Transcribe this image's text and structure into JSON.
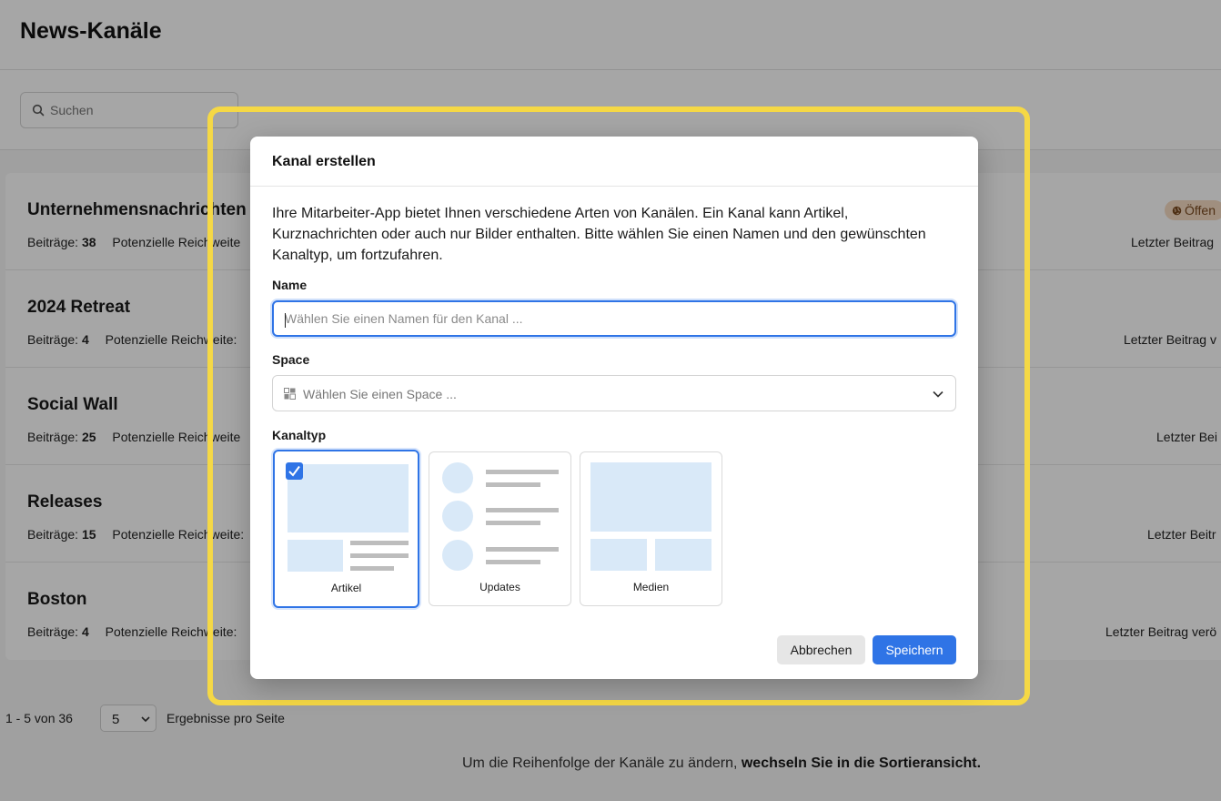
{
  "page": {
    "title": "News-Kanäle",
    "search_placeholder": "Suchen"
  },
  "channels": [
    {
      "name": "Unternehmensnachrichten",
      "posts_label": "Beiträge:",
      "posts": "38",
      "reach_label": "Potenzielle Reichweite",
      "last": "Letzter Beitrag",
      "badge": "Öffen"
    },
    {
      "name": "2024 Retreat",
      "posts_label": "Beiträge:",
      "posts": "4",
      "reach_label": "Potenzielle Reichweite:",
      "last": "Letzter Beitrag v"
    },
    {
      "name": "Social Wall",
      "posts_label": "Beiträge:",
      "posts": "25",
      "reach_label": "Potenzielle Reichweite",
      "last": "Letzter Bei"
    },
    {
      "name": "Releases",
      "posts_label": "Beiträge:",
      "posts": "15",
      "reach_label": "Potenzielle Reichweite:",
      "last": "Letzter Beitr"
    },
    {
      "name": "Boston",
      "posts_label": "Beiträge:",
      "posts": "4",
      "reach_label": "Potenzielle Reichweite:",
      "last": "Letzter Beitrag verö"
    }
  ],
  "pagination": {
    "range": "1 - 5 von 36",
    "page_size": "5",
    "per_page_label": "Ergebnisse pro Seite"
  },
  "sort_hint": {
    "text": "Um die Reihenfolge der Kanäle zu ändern, ",
    "link": "wechseln Sie in die Sortieransicht."
  },
  "modal": {
    "title": "Kanal erstellen",
    "description": "Ihre Mitarbeiter-App bietet Ihnen verschiedene Arten von Kanälen. Ein Kanal kann Artikel, Kurznachrichten oder auch nur Bilder enthalten. Bitte wählen Sie einen Namen und den gewünschten Kanaltyp, um fortzufahren.",
    "name_label": "Name",
    "name_placeholder": "Wählen Sie einen Namen für den Kanal ...",
    "space_label": "Space",
    "space_placeholder": "Wählen Sie einen Space ...",
    "type_label": "Kanaltyp",
    "types": [
      {
        "label": "Artikel",
        "selected": true
      },
      {
        "label": "Updates",
        "selected": false
      },
      {
        "label": "Medien",
        "selected": false
      }
    ],
    "cancel_label": "Abbrechen",
    "save_label": "Speichern"
  },
  "colors": {
    "accent": "#2f74e6",
    "highlight": "#f5d845",
    "preview_fill": "#d9e9f8",
    "preview_line": "#bdbdbd"
  }
}
